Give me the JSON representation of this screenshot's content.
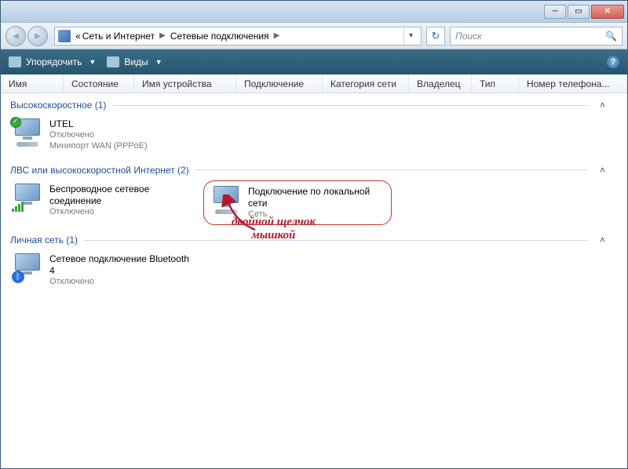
{
  "titlebar": {},
  "address": {
    "prefix": "«",
    "crumb1": "Сеть и Интернет",
    "crumb2": "Сетевые подключения"
  },
  "search": {
    "placeholder": "Поиск"
  },
  "toolbar": {
    "organize": "Упорядочить",
    "views": "Виды"
  },
  "columns": [
    "Имя",
    "Состояние",
    "Имя устройства",
    "Подключение",
    "Категория сети",
    "Владелец",
    "Тип",
    "Номер телефона..."
  ],
  "groups": [
    {
      "title": "Высокоскоростное (1)",
      "items": [
        {
          "name": "UTEL",
          "status": "Отключено",
          "device": "Минипорт WAN (PPPoE)",
          "icon": "dialup-ok"
        }
      ]
    },
    {
      "title": "ЛВС или высокоскоростной Интернет (2)",
      "items": [
        {
          "name": "Беспроводное сетевое соединение",
          "status": "Отключено",
          "device": "",
          "icon": "wifi"
        },
        {
          "name": "Подключение по локальной сети",
          "status": "Сеть",
          "device": "",
          "icon": "lan",
          "highlighted": true
        }
      ]
    },
    {
      "title": "Личная сеть (1)",
      "items": [
        {
          "name": "Сетевое подключение Bluetooth 4",
          "status": "Отключено",
          "device": "",
          "icon": "bluetooth"
        }
      ]
    }
  ],
  "annotation": {
    "line1": "двойной щелчок",
    "line2": "мышкой"
  }
}
